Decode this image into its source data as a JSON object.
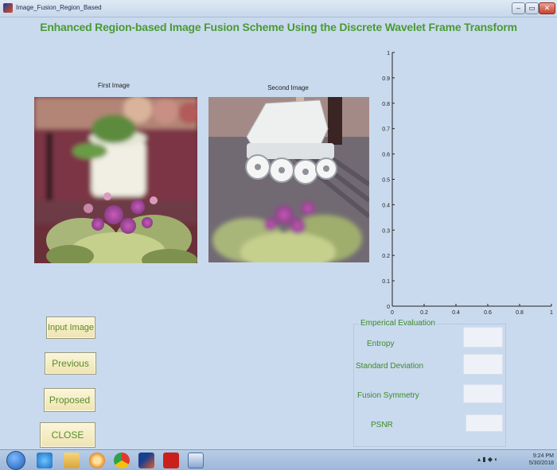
{
  "window": {
    "title": "Image_Fusion_Region_Based",
    "minimize_glyph": "–",
    "maximize_glyph": "▭",
    "close_glyph": "✕"
  },
  "heading": "Enhanced Region-based Image Fusion Scheme Using the Discrete Wavelet Frame Transform",
  "images": {
    "first_label": "First Image",
    "second_label": "Second Image"
  },
  "chart_data": {
    "type": "line",
    "series": [],
    "xlim": [
      0,
      1
    ],
    "ylim": [
      0,
      1
    ],
    "x_ticks": [
      "0",
      "0.2",
      "0.4",
      "0.6",
      "0.8",
      "1"
    ],
    "y_ticks": [
      "0",
      "0.1",
      "0.2",
      "0.3",
      "0.4",
      "0.5",
      "0.6",
      "0.7",
      "0.8",
      "0.9",
      "1"
    ],
    "grid": false
  },
  "buttons": {
    "input_image": "Input Image",
    "previous": "Previous",
    "proposed": "Proposed",
    "close": "CLOSE"
  },
  "evaluation": {
    "title": "Emperical Evaluation",
    "entropy_label": "Entropy",
    "std_label": "Standard Deviation",
    "fusion_symmetry_label": "Fusion Symmetry",
    "psnr_label": "PSNR",
    "entropy_value": "",
    "std_value": "",
    "fusion_symmetry_value": "",
    "psnr_value": ""
  },
  "taskbar": {
    "icons": [
      "start-orb-icon",
      "ie-icon",
      "explorer-folder-icon",
      "media-player-icon",
      "chrome-icon",
      "matlab-icon",
      "acrobat-icon",
      "word-doc-icon"
    ],
    "clock_time": "9:24 PM",
    "clock_date": "5/30/2018"
  }
}
